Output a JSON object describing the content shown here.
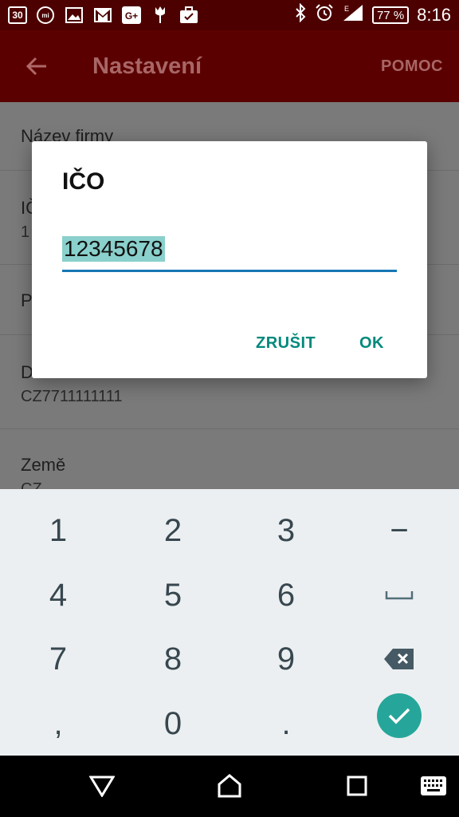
{
  "status_bar": {
    "notification_icons": [
      "calendar-icon",
      "mi-icon",
      "image-icon",
      "gmail-icon",
      "google-plus-icon",
      "tulip-icon",
      "briefcase-icon"
    ],
    "calendar_day": "30",
    "battery": "77 %",
    "time": "8:16"
  },
  "app_bar": {
    "title": "Nastavení",
    "help_label": "POMOC"
  },
  "settings": {
    "company_name_label": "Název firmy",
    "ico_label_partial": "IČ",
    "ico_value_partial": "1",
    "row3_partial": "P",
    "dic_label_partial": "D",
    "dic_value": "CZ7711111111",
    "country_label": "Země",
    "country_value": "CZ"
  },
  "dialog": {
    "title": "IČO",
    "input_value": "12345678",
    "cancel_label": "ZRUŠIT",
    "ok_label": "OK"
  },
  "keyboard": {
    "keys": [
      "1",
      "2",
      "3",
      "−",
      "4",
      "5",
      "6",
      "",
      "7",
      "8",
      "9",
      "",
      ",",
      "0",
      ".",
      ""
    ],
    "icons": [
      "space-icon",
      "backspace-icon",
      "done-check-icon"
    ]
  },
  "colors": {
    "app_bar": "#5b0000",
    "accent": "#00897b",
    "input_underline": "#1677b4"
  }
}
